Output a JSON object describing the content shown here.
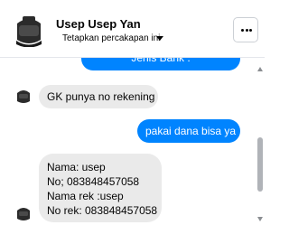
{
  "header": {
    "contact_name": "Usep Usep Yan",
    "subtitle": "Tetapkan percakapan ini",
    "more_icon": "more-options-icon"
  },
  "messages": [
    {
      "side": "out",
      "text": "Jenis Bank :"
    },
    {
      "side": "in",
      "text": "GK punya no rekening"
    },
    {
      "side": "out",
      "text": "pakai dana bisa ya"
    },
    {
      "side": "in",
      "lines": [
        "Nama: usep",
        "No; 083848457058",
        "Nama rek :usep",
        "No rek: 083848457058"
      ]
    }
  ],
  "colors": {
    "accent": "#0084ff",
    "incoming_bubble": "#eaeaea",
    "text": "#050505"
  }
}
